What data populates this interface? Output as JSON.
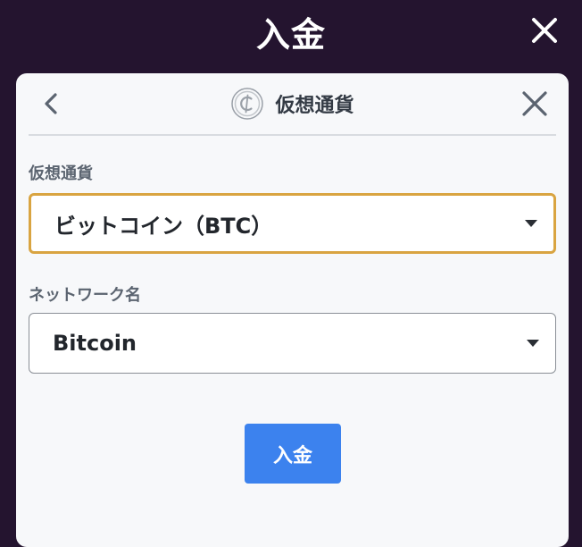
{
  "header": {
    "title": "入金",
    "close_icon": "close-icon"
  },
  "panel": {
    "back_icon": "chevron-left-icon",
    "title": "仮想通貨",
    "title_icon": "coin-icon",
    "close_icon": "close-icon"
  },
  "form": {
    "currency": {
      "label": "仮想通貨",
      "selected": "ビットコイン（BTC）"
    },
    "network": {
      "label": "ネットワーク名",
      "selected": "Bitcoin"
    },
    "submit_label": "入金"
  },
  "colors": {
    "background": "#24142f",
    "panel": "#f7f8fa",
    "focus_border": "#d9a441",
    "button": "#3c82ee"
  }
}
